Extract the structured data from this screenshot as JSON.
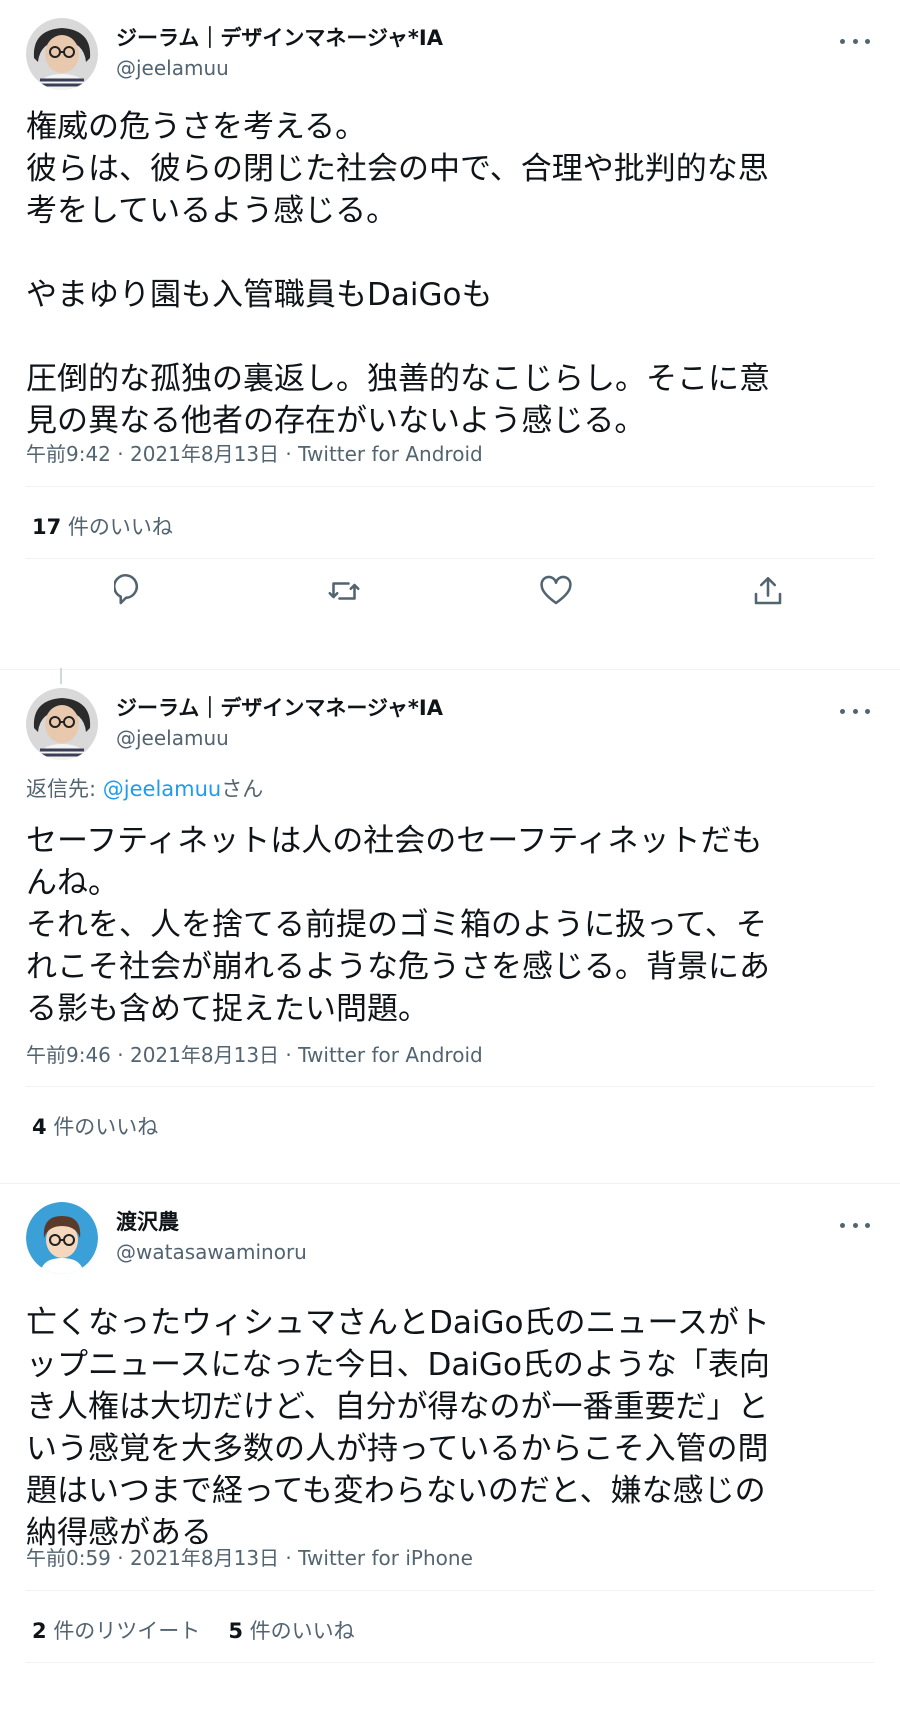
{
  "tweets": [
    {
      "author": {
        "name": "ジーラム｜デザインマネージャ*IA",
        "handle": "@jeelamuu"
      },
      "text": "権威の危うさを考える。\n彼らは、彼らの閉じた社会の中で、合理や批判的な思\n考をしているよう感じる。\n\nやまゆり園も入管職員もDaiGoも\n\n圧倒的な孤独の裏返し。独善的なこじらし。そこに意\n見の異なる他者の存在がいないよう感じる。",
      "meta": "午前9:42 · 2021年8月13日 · Twitter for Android",
      "likes_count": "17",
      "likes_label": "件のいいね"
    },
    {
      "author": {
        "name": "ジーラム｜デザインマネージャ*IA",
        "handle": "@jeelamuu"
      },
      "reply_prefix": "返信先: ",
      "reply_mention": "@jeelamuu",
      "reply_suffix": "さん",
      "text": "セーフティネットは人の社会のセーフティネットだも\nんね。\nそれを、人を捨てる前提のゴミ箱のように扱って、そ\nれこそ社会が崩れるような危うさを感じる。背景にあ\nる影も含めて捉えたい問題。",
      "meta": "午前9:46 · 2021年8月13日 · Twitter for Android",
      "likes_count": "4",
      "likes_label": "件のいいね"
    },
    {
      "author": {
        "name": "渡沢農",
        "handle": "@watasawaminoru"
      },
      "text": "亡くなったウィシュマさんとDaiGo氏のニュースがト\nップニュースになった今日、DaiGo氏のような「表向\nき人権は大切だけど、自分が得なのが一番重要だ」と\nいう感覚を大多数の人が持っているからこそ入管の問\n題はいつまで経っても変わらないのだと、嫌な感じの\n納得感がある",
      "meta": "午前0:59 · 2021年8月13日 · Twitter for iPhone",
      "retweets_count": "2",
      "retweets_label": "件のリツイート",
      "likes_count": "5",
      "likes_label": "件のいいね"
    }
  ],
  "icons": {
    "more": "more-horizontal-icon",
    "reply": "reply-bubble-icon",
    "retweet": "retweet-arrows-icon",
    "like": "heart-icon",
    "share": "share-upload-icon"
  },
  "colors": {
    "text": "#0f1419",
    "secondary": "#536471",
    "link": "#1d9bf0",
    "divider": "#eff3f4"
  }
}
